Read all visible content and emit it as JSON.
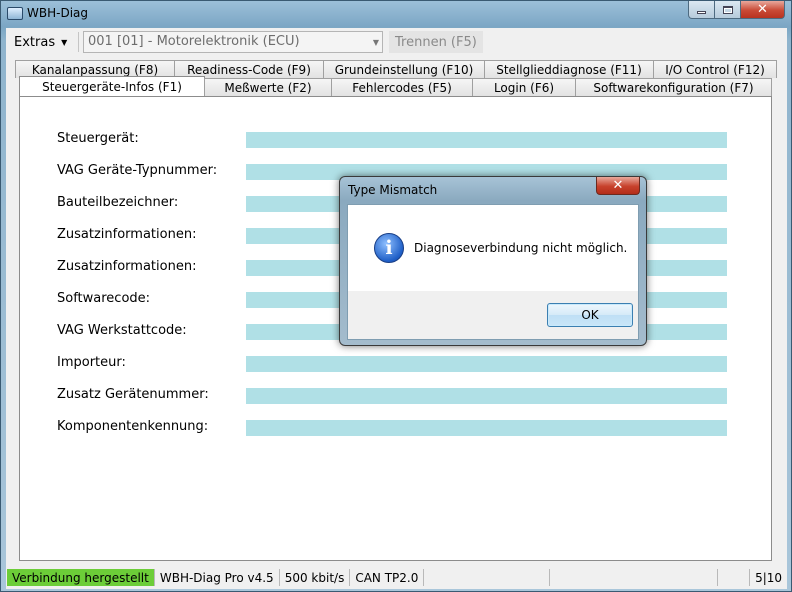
{
  "window": {
    "title": "WBH-Diag",
    "controls": {
      "minimize": "",
      "maximize": "",
      "close": "✕"
    }
  },
  "toolbar": {
    "extras_label": "Extras",
    "ecu_selected": "001 [01] - Motorelektronik (ECU)",
    "trennen_label": "Trennen (F5)"
  },
  "tabs": {
    "row1": [
      "Kanalanpassung (F8)",
      "Readiness-Code (F9)",
      "Grundeinstellung  (F10)",
      "Stellglieddiagnose (F11)",
      "I/O Control (F12)"
    ],
    "row2": [
      "Steuergeräte-Infos (F1)",
      "Meßwerte (F2)",
      "Fehlercodes (F5)",
      "Login (F6)",
      "Softwarekonfiguration (F7)"
    ],
    "active": "Steuergeräte-Infos (F1)"
  },
  "fields": [
    {
      "label": "Steuergerät:",
      "value": ""
    },
    {
      "label": "VAG Geräte-Typnummer:",
      "value": ""
    },
    {
      "label": "Bauteilbezeichner:",
      "value": ""
    },
    {
      "label": "Zusatzinformationen:",
      "value": ""
    },
    {
      "label": "Zusatzinformationen:",
      "value": ""
    },
    {
      "label": "Softwarecode:",
      "value": ""
    },
    {
      "label": "VAG Werkstattcode:",
      "value": ""
    },
    {
      "label": "Importeur:",
      "value": ""
    },
    {
      "label": "Zusatz Gerätenummer:",
      "value": ""
    },
    {
      "label": "Komponentenkennung:",
      "value": ""
    }
  ],
  "statusbar": {
    "connection": "Verbindung hergestellt",
    "version": "WBH-Diag Pro v4.5",
    "baud": "500 kbit/s",
    "protocol": "CAN TP2.0",
    "counter": "5|10"
  },
  "dialog": {
    "title": "Type Mismatch",
    "close": "✕",
    "icon": "info-icon",
    "icon_glyph": "i",
    "message": "Diagnoseverbindung nicht möglich.",
    "ok_label": "OK"
  },
  "colors": {
    "field_fill": "#b0e0e6",
    "status_ok": "#6ccd38",
    "close_red": "#c7412c"
  }
}
